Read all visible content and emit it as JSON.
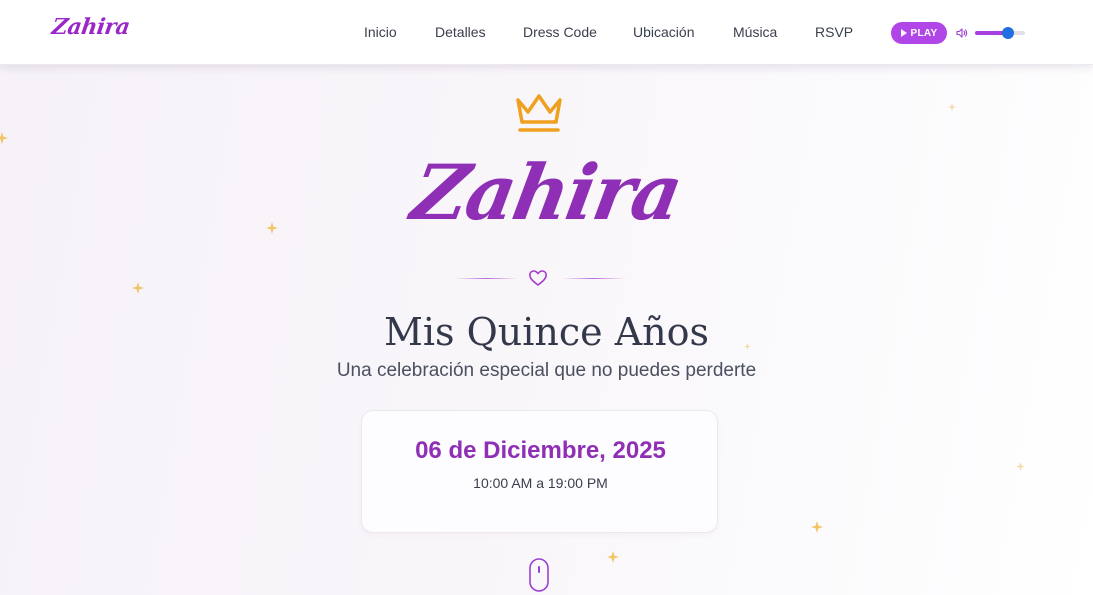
{
  "navbar": {
    "brand": "Zahira",
    "links": [
      "Inicio",
      "Detalles",
      "Dress Code",
      "Ubicación",
      "Música",
      "RSVP"
    ],
    "play_label": "PLAY",
    "volume_level": 0.65
  },
  "hero": {
    "name": "Zahira",
    "subtitle": "Mis Quince Años",
    "tagline": "Una celebración especial que no puedes perderte",
    "date": "06 de Diciembre, 2025",
    "time": "10:00 AM a 19:00 PM"
  },
  "colors": {
    "accent": "#8e2fb5",
    "play_button": "#b045e8",
    "crown": "#f0a020",
    "sparkle": "#f2c466"
  },
  "icons": [
    "crown-icon",
    "heart-icon",
    "play-icon",
    "volume-icon",
    "mouse-scroll-icon",
    "sparkle-icon"
  ]
}
